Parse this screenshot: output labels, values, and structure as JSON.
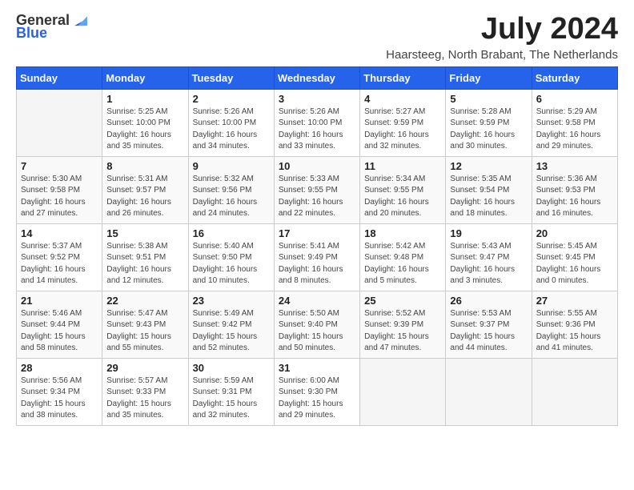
{
  "logo": {
    "text_general": "General",
    "text_blue": "Blue",
    "tagline": "GeneralBlue"
  },
  "title": "July 2024",
  "location": "Haarsteeg, North Brabant, The Netherlands",
  "days_of_week": [
    "Sunday",
    "Monday",
    "Tuesday",
    "Wednesday",
    "Thursday",
    "Friday",
    "Saturday"
  ],
  "weeks": [
    [
      {
        "day": "",
        "info": ""
      },
      {
        "day": "1",
        "info": "Sunrise: 5:25 AM\nSunset: 10:00 PM\nDaylight: 16 hours\nand 35 minutes."
      },
      {
        "day": "2",
        "info": "Sunrise: 5:26 AM\nSunset: 10:00 PM\nDaylight: 16 hours\nand 34 minutes."
      },
      {
        "day": "3",
        "info": "Sunrise: 5:26 AM\nSunset: 10:00 PM\nDaylight: 16 hours\nand 33 minutes."
      },
      {
        "day": "4",
        "info": "Sunrise: 5:27 AM\nSunset: 9:59 PM\nDaylight: 16 hours\nand 32 minutes."
      },
      {
        "day": "5",
        "info": "Sunrise: 5:28 AM\nSunset: 9:59 PM\nDaylight: 16 hours\nand 30 minutes."
      },
      {
        "day": "6",
        "info": "Sunrise: 5:29 AM\nSunset: 9:58 PM\nDaylight: 16 hours\nand 29 minutes."
      }
    ],
    [
      {
        "day": "7",
        "info": "Sunrise: 5:30 AM\nSunset: 9:58 PM\nDaylight: 16 hours\nand 27 minutes."
      },
      {
        "day": "8",
        "info": "Sunrise: 5:31 AM\nSunset: 9:57 PM\nDaylight: 16 hours\nand 26 minutes."
      },
      {
        "day": "9",
        "info": "Sunrise: 5:32 AM\nSunset: 9:56 PM\nDaylight: 16 hours\nand 24 minutes."
      },
      {
        "day": "10",
        "info": "Sunrise: 5:33 AM\nSunset: 9:55 PM\nDaylight: 16 hours\nand 22 minutes."
      },
      {
        "day": "11",
        "info": "Sunrise: 5:34 AM\nSunset: 9:55 PM\nDaylight: 16 hours\nand 20 minutes."
      },
      {
        "day": "12",
        "info": "Sunrise: 5:35 AM\nSunset: 9:54 PM\nDaylight: 16 hours\nand 18 minutes."
      },
      {
        "day": "13",
        "info": "Sunrise: 5:36 AM\nSunset: 9:53 PM\nDaylight: 16 hours\nand 16 minutes."
      }
    ],
    [
      {
        "day": "14",
        "info": "Sunrise: 5:37 AM\nSunset: 9:52 PM\nDaylight: 16 hours\nand 14 minutes."
      },
      {
        "day": "15",
        "info": "Sunrise: 5:38 AM\nSunset: 9:51 PM\nDaylight: 16 hours\nand 12 minutes."
      },
      {
        "day": "16",
        "info": "Sunrise: 5:40 AM\nSunset: 9:50 PM\nDaylight: 16 hours\nand 10 minutes."
      },
      {
        "day": "17",
        "info": "Sunrise: 5:41 AM\nSunset: 9:49 PM\nDaylight: 16 hours\nand 8 minutes."
      },
      {
        "day": "18",
        "info": "Sunrise: 5:42 AM\nSunset: 9:48 PM\nDaylight: 16 hours\nand 5 minutes."
      },
      {
        "day": "19",
        "info": "Sunrise: 5:43 AM\nSunset: 9:47 PM\nDaylight: 16 hours\nand 3 minutes."
      },
      {
        "day": "20",
        "info": "Sunrise: 5:45 AM\nSunset: 9:45 PM\nDaylight: 16 hours\nand 0 minutes."
      }
    ],
    [
      {
        "day": "21",
        "info": "Sunrise: 5:46 AM\nSunset: 9:44 PM\nDaylight: 15 hours\nand 58 minutes."
      },
      {
        "day": "22",
        "info": "Sunrise: 5:47 AM\nSunset: 9:43 PM\nDaylight: 15 hours\nand 55 minutes."
      },
      {
        "day": "23",
        "info": "Sunrise: 5:49 AM\nSunset: 9:42 PM\nDaylight: 15 hours\nand 52 minutes."
      },
      {
        "day": "24",
        "info": "Sunrise: 5:50 AM\nSunset: 9:40 PM\nDaylight: 15 hours\nand 50 minutes."
      },
      {
        "day": "25",
        "info": "Sunrise: 5:52 AM\nSunset: 9:39 PM\nDaylight: 15 hours\nand 47 minutes."
      },
      {
        "day": "26",
        "info": "Sunrise: 5:53 AM\nSunset: 9:37 PM\nDaylight: 15 hours\nand 44 minutes."
      },
      {
        "day": "27",
        "info": "Sunrise: 5:55 AM\nSunset: 9:36 PM\nDaylight: 15 hours\nand 41 minutes."
      }
    ],
    [
      {
        "day": "28",
        "info": "Sunrise: 5:56 AM\nSunset: 9:34 PM\nDaylight: 15 hours\nand 38 minutes."
      },
      {
        "day": "29",
        "info": "Sunrise: 5:57 AM\nSunset: 9:33 PM\nDaylight: 15 hours\nand 35 minutes."
      },
      {
        "day": "30",
        "info": "Sunrise: 5:59 AM\nSunset: 9:31 PM\nDaylight: 15 hours\nand 32 minutes."
      },
      {
        "day": "31",
        "info": "Sunrise: 6:00 AM\nSunset: 9:30 PM\nDaylight: 15 hours\nand 29 minutes."
      },
      {
        "day": "",
        "info": ""
      },
      {
        "day": "",
        "info": ""
      },
      {
        "day": "",
        "info": ""
      }
    ]
  ]
}
